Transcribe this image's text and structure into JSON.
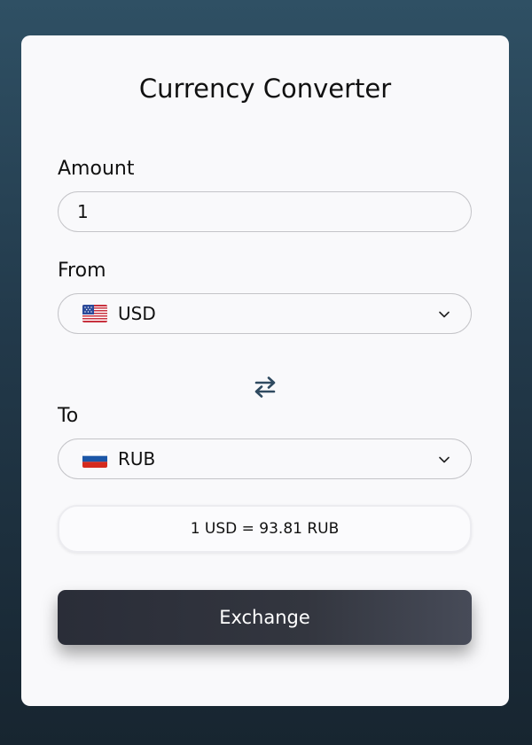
{
  "title": "Currency Converter",
  "amount": {
    "label": "Amount",
    "value": "1"
  },
  "from": {
    "label": "From",
    "flag": "us-flag-icon",
    "code": "USD"
  },
  "to": {
    "label": "To",
    "flag": "ru-flag-icon",
    "code": "RUB"
  },
  "swap_icon": "swap-arrows-icon",
  "rate_text": "1 USD = 93.81 RUB",
  "exchange_label": "Exchange",
  "colors": {
    "background_top": "#2f5064",
    "background_bottom": "#172530",
    "card": "#f9f9fb",
    "button": "#2a2d38",
    "swap_icon": "#2f4a60"
  }
}
